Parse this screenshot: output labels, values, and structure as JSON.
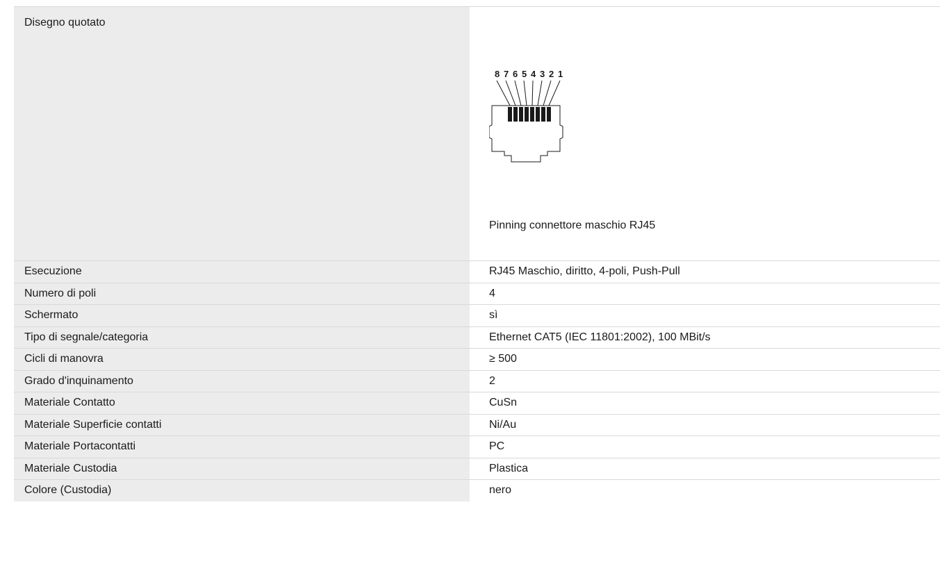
{
  "drawing": {
    "label": "Disegno quotato",
    "caption": "Pinning connettore maschio RJ45",
    "pin_numbers": [
      "8",
      "7",
      "6",
      "5",
      "4",
      "3",
      "2",
      "1"
    ]
  },
  "specs": [
    {
      "label": "Esecuzione",
      "value": "RJ45 Maschio, diritto, 4-poli, Push-Pull"
    },
    {
      "label": "Numero di poli",
      "value": "4"
    },
    {
      "label": "Schermato",
      "value": "sì"
    },
    {
      "label": "Tipo di segnale/categoria",
      "value": "Ethernet CAT5 (IEC 11801:2002), 100 MBit/s"
    },
    {
      "label": "Cicli di manovra",
      "value": "≥ 500"
    },
    {
      "label": "Grado d'inquinamento",
      "value": "2"
    },
    {
      "label": "Materiale Contatto",
      "value": "CuSn"
    },
    {
      "label": "Materiale Superficie contatti",
      "value": "Ni/Au"
    },
    {
      "label": "Materiale Portacontatti",
      "value": "PC"
    },
    {
      "label": "Materiale Custodia",
      "value": "Plastica"
    },
    {
      "label": "Colore (Custodia)",
      "value": "nero"
    }
  ]
}
